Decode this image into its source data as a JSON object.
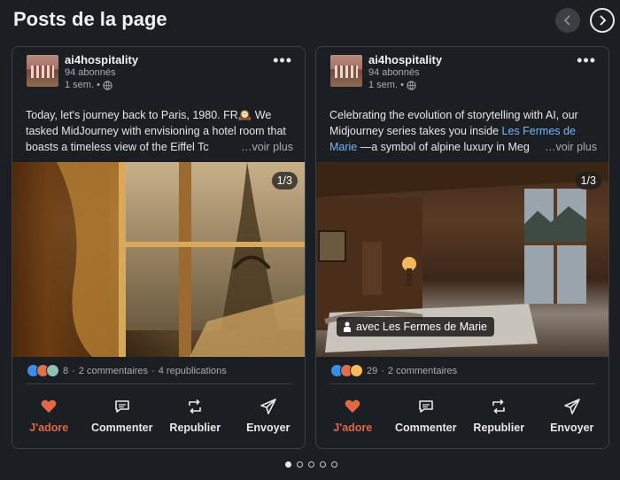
{
  "section": {
    "title": "Posts de la page"
  },
  "nav": {
    "prev_icon": "chevron-left-icon",
    "next_icon": "chevron-right-icon"
  },
  "posts": [
    {
      "author": "ai4hospitality",
      "followers": "94 abonnés",
      "time": "1 sem. •",
      "text_parts": [
        "Today, let's journey back to Paris, 1980. FR🕰️ We tasked MidJourney with envisioning a hotel room that boasts a timeless view of the Eiffel Tc"
      ],
      "see_more": "…voir plus",
      "image_counter": "1/3",
      "reactions": [
        "like",
        "love",
        "celebrate"
      ],
      "reaction_count": "8",
      "comments": "2 commentaires",
      "reposts": "4 republications"
    },
    {
      "author": "ai4hospitality",
      "followers": "94 abonnés",
      "time": "1 sem. •",
      "text_before": "Celebrating the evolution of storytelling with AI, our Midjourney series takes you inside ",
      "text_link": "Les Fermes de Marie",
      "text_after": " —a symbol of alpine luxury in Meg",
      "see_more": "…voir plus",
      "image_counter": "1/3",
      "tag": "avec Les Fermes de Marie",
      "reactions": [
        "like",
        "love",
        "insight"
      ],
      "reaction_count": "29",
      "comments": "2 commentaires"
    }
  ],
  "actions": {
    "love": "J'adore",
    "comment": "Commenter",
    "repost": "Republier",
    "send": "Envoyer"
  },
  "pagination": {
    "total": 5,
    "current": 1
  },
  "colors": {
    "accent_love": "#e16745",
    "link": "#71b7fb"
  }
}
